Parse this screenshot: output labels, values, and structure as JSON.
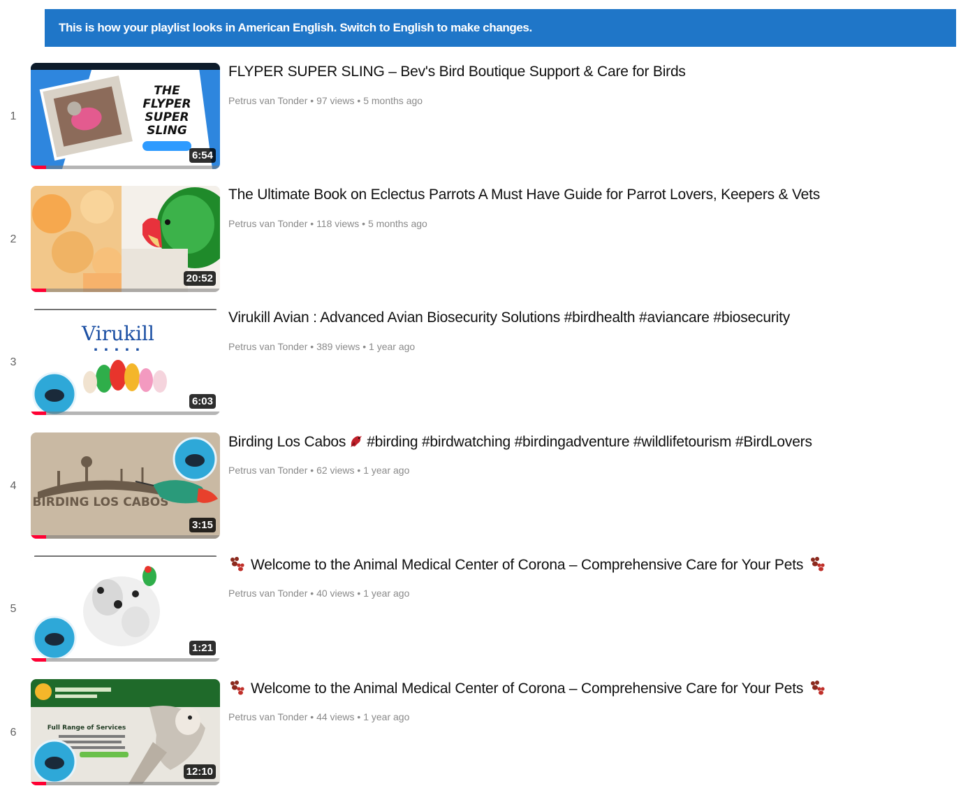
{
  "banner": {
    "text": "This is how your playlist looks in American English. Switch to English to make changes."
  },
  "videos": [
    {
      "index": "1",
      "title": "FLYPER SUPER SLING – Bev's Bird Boutique Support & Care for Birds",
      "channel": "Petrus van Tonder",
      "views": "97 views",
      "age": "5 months ago",
      "duration": "6:54",
      "watched_fraction": 0.08,
      "thumb_text": [
        "THE",
        "FLYPER",
        "SUPER",
        "SLING"
      ]
    },
    {
      "index": "2",
      "title": "The Ultimate Book on Eclectus Parrots A Must Have Guide for Parrot Lovers, Keepers & Vets",
      "channel": "Petrus van Tonder",
      "views": "118 views",
      "age": "5 months ago",
      "duration": "20:52",
      "watched_fraction": 0.08
    },
    {
      "index": "3",
      "title": "Virukill Avian : Advanced Avian Biosecurity Solutions #birdhealth #aviancare #biosecurity",
      "channel": "Petrus van Tonder",
      "views": "389 views",
      "age": "1 year ago",
      "duration": "6:03",
      "watched_fraction": 0.08,
      "thumb_text": [
        "Virukill"
      ]
    },
    {
      "index": "4",
      "title_before": "Birding Los Cabos",
      "title_after": "#birding #birdwatching #birdingadventure #wildlifetourism #BirdLovers",
      "channel": "Petrus van Tonder",
      "views": "62 views",
      "age": "1 year ago",
      "duration": "3:15",
      "watched_fraction": 0.08,
      "thumb_text": [
        "BIRDING LOS CABOS"
      ]
    },
    {
      "index": "5",
      "title": "Welcome to the Animal Medical Center of Corona – Comprehensive Care for Your Pets",
      "channel": "Petrus van Tonder",
      "views": "40 views",
      "age": "1 year ago",
      "duration": "1:21",
      "watched_fraction": 0.08
    },
    {
      "index": "6",
      "title": "Welcome to the Animal Medical Center of Corona – Comprehensive Care for Your Pets",
      "channel": "Petrus van Tonder",
      "views": "44 views",
      "age": "1 year ago",
      "duration": "12:10",
      "watched_fraction": 0.08,
      "thumb_text": [
        "Full Range of Services"
      ]
    }
  ],
  "meta_separator": "•",
  "colors": {
    "banner": "#1f76c8",
    "progress": "#ff0033"
  }
}
